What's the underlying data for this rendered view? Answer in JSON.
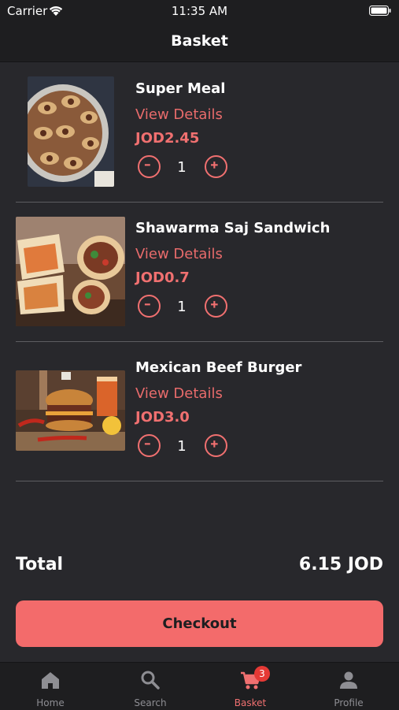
{
  "status": {
    "carrier": "Carrier",
    "time": "11:35 AM"
  },
  "nav": {
    "title": "Basket"
  },
  "items": [
    {
      "name": "Super Meal",
      "details_label": "View Details",
      "price": "JOD2.45",
      "quantity": "1",
      "image": "super-meal-image"
    },
    {
      "name": "Shawarma Saj Sandwich",
      "details_label": "View Details",
      "price": "JOD0.7",
      "quantity": "1",
      "image": "shawarma-sandwich-image"
    },
    {
      "name": "Mexican Beef Burger",
      "details_label": "View Details",
      "price": "JOD3.0",
      "quantity": "1",
      "image": "beef-burger-image"
    }
  ],
  "summary": {
    "total_label": "Total",
    "total_value": "6.15 JOD"
  },
  "checkout": {
    "label": "Checkout"
  },
  "tabs": [
    {
      "label": "Home",
      "icon": "home-icon"
    },
    {
      "label": "Search",
      "icon": "search-icon"
    },
    {
      "label": "Basket",
      "icon": "cart-icon",
      "badge": "3",
      "active": true
    },
    {
      "label": "Profile",
      "icon": "profile-icon"
    }
  ],
  "colors": {
    "accent": "#f36b6b",
    "background": "#28282c",
    "bar": "#1e1e20"
  }
}
